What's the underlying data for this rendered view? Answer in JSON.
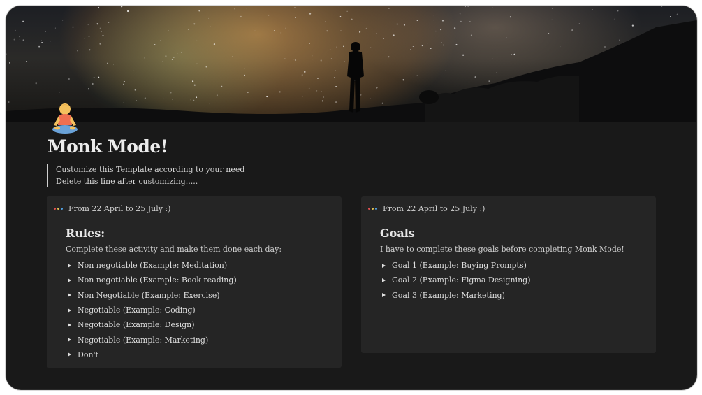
{
  "page": {
    "icon": "meditation-emoji-icon",
    "title": "Monk Mode!",
    "note_lines": [
      "Customize this Template according to your need",
      "Delete this line after customizing....."
    ]
  },
  "rules_callout": {
    "icon": "dots-icon",
    "header": "From 22 April to 25 July :)",
    "heading": "Rules:",
    "subtitle": "Complete these activity and make them done each day:",
    "items": [
      "Non negotiable (Example: Meditation)",
      "Non negotiable (Example: Book reading)",
      "Non Negotiable (Example: Exercise)",
      "Negotiable (Example: Coding)",
      "Negotiable (Example: Design)",
      "Negotiable (Example: Marketing)",
      "Don't"
    ]
  },
  "goals_callout": {
    "icon": "dots-icon",
    "header": "From 22 April to 25 July :)",
    "heading": "Goals",
    "subtitle": "I have to complete these goals before completing Monk Mode!",
    "items": [
      "Goal 1 (Example: Buying Prompts)",
      "Goal 2 (Example: Figma Designing)",
      "Goal 3 (Example: Marketing)"
    ]
  },
  "colors": {
    "background": "#191919",
    "card": "#252525",
    "text": "#e6e6e6"
  }
}
